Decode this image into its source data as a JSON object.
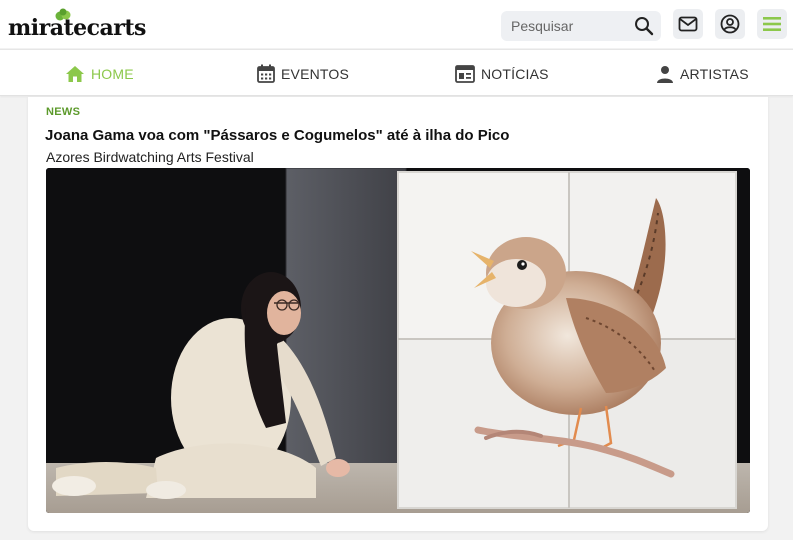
{
  "header": {
    "logo_text": "miratecarts",
    "search": {
      "placeholder": "Pesquisar"
    },
    "icons": [
      "search-icon",
      "mail-icon",
      "user-icon",
      "menu-icon"
    ]
  },
  "nav": {
    "items": [
      {
        "label": "HOME",
        "icon": "home-icon",
        "active": true
      },
      {
        "label": "EVENTOS",
        "icon": "calendar-icon",
        "active": false
      },
      {
        "label": "NOTÍCIAS",
        "icon": "newspaper-icon",
        "active": false
      },
      {
        "label": "ARTISTAS",
        "icon": "person-icon",
        "active": false
      }
    ]
  },
  "article": {
    "tag": "NEWS",
    "title": "Joana Gama voa com \"Pássaros e Cogumelos\" até à ilha do Pico",
    "subtitle": "Azores Birdwatching Arts Festival"
  },
  "colors": {
    "accent": "#8cc84b",
    "tag": "#5c9a2b",
    "background": "#f2f2f2"
  }
}
